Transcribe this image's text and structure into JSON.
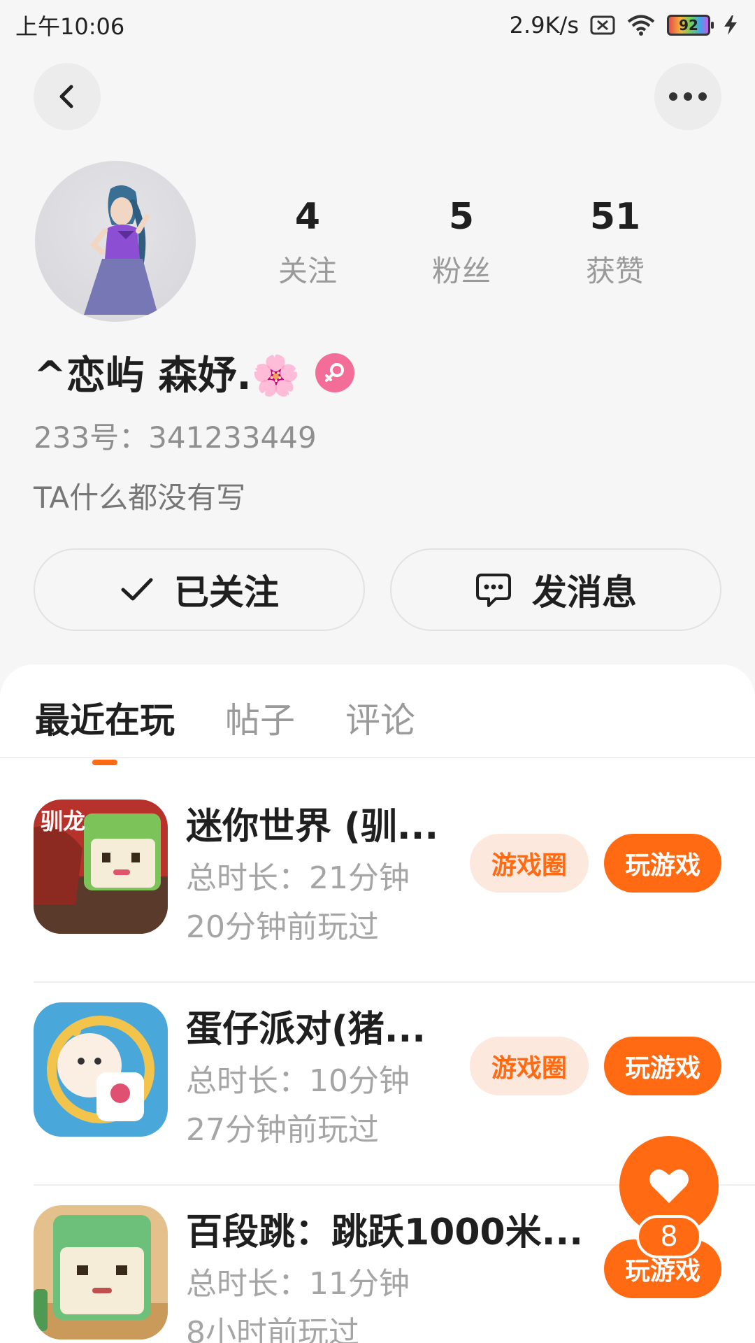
{
  "status_bar": {
    "time": "上午10:06",
    "net_speed": "2.9K/s",
    "battery": "92"
  },
  "header": {
    "back_icon": "chevron-left-icon",
    "more_icon": "more-horizontal-icon"
  },
  "profile": {
    "stats": [
      {
        "value": "4",
        "label": "关注"
      },
      {
        "value": "5",
        "label": "粉丝"
      },
      {
        "value": "51",
        "label": "获赞"
      }
    ],
    "username": "^恋屿 森妤.🌸",
    "id_line": "233号：341233449",
    "bio": "TA什么都没有写"
  },
  "actions": {
    "follow_label": "已关注",
    "message_label": "发消息"
  },
  "tabs": [
    {
      "label": "最近在玩",
      "active": true
    },
    {
      "label": "帖子",
      "active": false
    },
    {
      "label": "评论",
      "active": false
    }
  ],
  "games": [
    {
      "title": "迷你世界 (驯...",
      "duration": "总时长：21分钟",
      "last_played": "20分钟前玩过",
      "circle_label": "游戏圈",
      "play_label": "玩游戏"
    },
    {
      "title": "蛋仔派对(猪...",
      "duration": "总时长：10分钟",
      "last_played": "27分钟前玩过",
      "circle_label": "游戏圈",
      "play_label": "玩游戏"
    },
    {
      "title": "百段跳：跳跃1000米...",
      "duration": "总时长：11分钟",
      "last_played": "8小时前玩过",
      "play_label": "玩游戏"
    }
  ],
  "like_fab": {
    "icon": "heart-icon",
    "count": "8"
  },
  "colors": {
    "accent": "#ff6a13",
    "accent_light": "#fde8de",
    "gender": "#f46d98"
  }
}
